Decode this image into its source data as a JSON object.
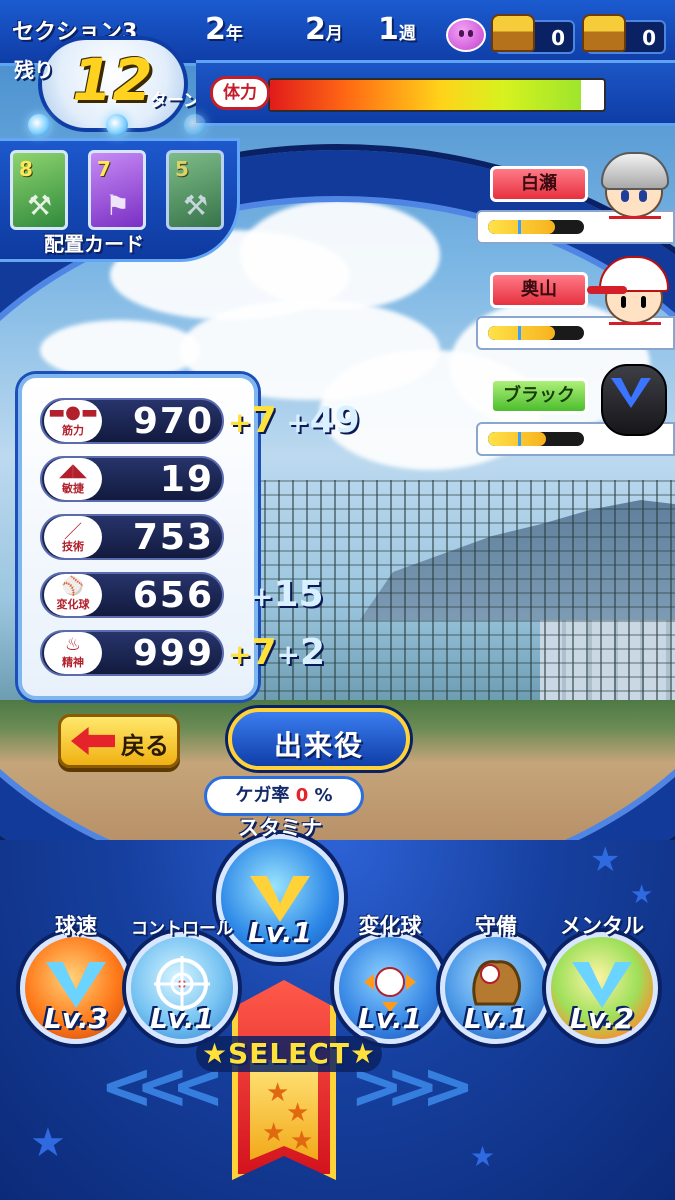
{
  "header": {
    "section_label": "セクション3",
    "year": "2",
    "year_unit": "年",
    "month": "2",
    "month_unit": "月",
    "week": "1",
    "week_unit": "週",
    "chest_counts": [
      "0",
      "0"
    ]
  },
  "turns": {
    "remaining_label": "残り",
    "count": "12",
    "unit": "ターン"
  },
  "stamina": {
    "label": "体力",
    "level": 0.93
  },
  "placement_cards": {
    "label": "配置カード",
    "cards": [
      {
        "number": "8",
        "color": "green"
      },
      {
        "number": "7",
        "color": "purple"
      },
      {
        "number": "5",
        "color": "green"
      }
    ]
  },
  "teammates": [
    {
      "name": "白瀬",
      "gauge": 0.7,
      "color": "#e6303f"
    },
    {
      "name": "奥山",
      "gauge": 0.7,
      "color": "#e6303f"
    },
    {
      "name": "ブラック",
      "gauge": 0.6,
      "color": "#4cbd2d"
    }
  ],
  "stats": [
    {
      "label": "筋力",
      "value": "970",
      "bonus_1": "7",
      "bonus_2": "49"
    },
    {
      "label": "敏捷",
      "value": "19"
    },
    {
      "label": "技術",
      "value": "753"
    },
    {
      "label": "変化球",
      "value": "656",
      "bonus_2": "15"
    },
    {
      "label": "精神",
      "value": "999",
      "bonus_1": "7",
      "bonus_2": "2"
    }
  ],
  "buttons": {
    "back_label": "戻る",
    "combo_label": "出来役"
  },
  "injury": {
    "label": "ケガ率",
    "value": "0",
    "unit": "%"
  },
  "training": [
    {
      "name": "スタミナ",
      "level": "Lv.1"
    },
    {
      "name": "球速",
      "level": "Lv.3"
    },
    {
      "name": "コントロール",
      "level": "Lv.1"
    },
    {
      "name": "変化球",
      "level": "Lv.1"
    },
    {
      "name": "守備",
      "level": "Lv.1"
    },
    {
      "name": "メンタル",
      "level": "Lv.2"
    }
  ],
  "select_label": "★SELECT★"
}
